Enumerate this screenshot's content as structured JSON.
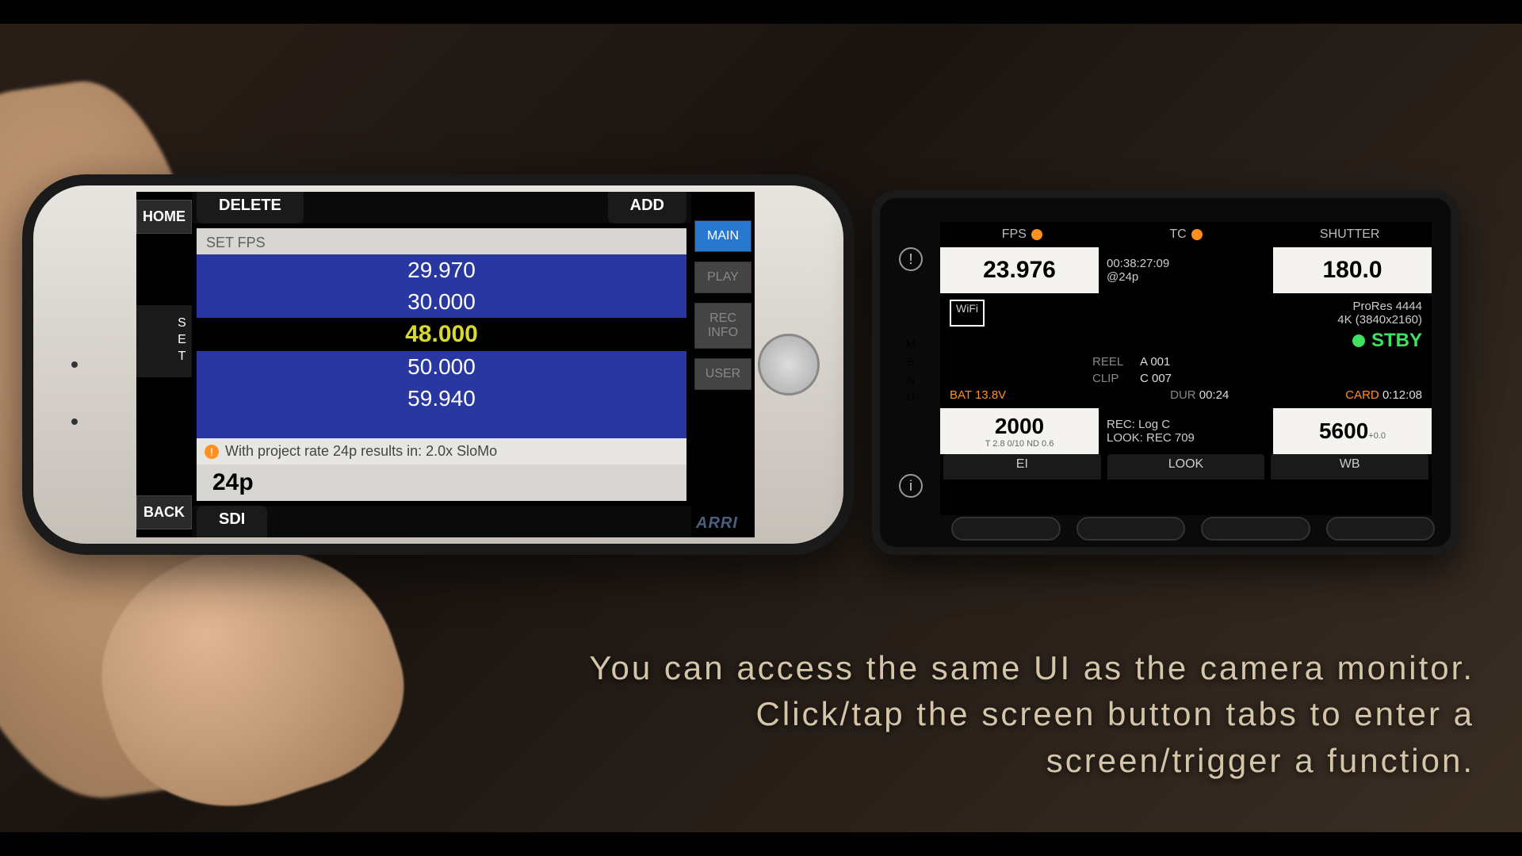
{
  "phone_app": {
    "home_label": "HOME",
    "back_label": "BACK",
    "set_label": "SET",
    "top_tabs": {
      "delete": "DELETE",
      "add": "ADD"
    },
    "bottom_tab": "SDI",
    "panel_title": "SET FPS",
    "fps_options": [
      "29.970",
      "30.000",
      "48.000",
      "50.000",
      "59.940"
    ],
    "fps_selected_index": 2,
    "info_text": "With project rate 24p results in: 2.0x SloMo",
    "current_rate": "24p",
    "right_buttons": [
      "MAIN",
      "PLAY",
      "REC INFO",
      "USER"
    ],
    "right_active_index": 0,
    "brand": "ARRI"
  },
  "camera": {
    "menu_label": "MENU",
    "header": {
      "fps": "FPS",
      "tc": "TC",
      "shutter": "SHUTTER"
    },
    "fps_value": "23.976",
    "tc_value": "00:38:27:09",
    "tc_sub": "@24p",
    "shutter_value": "180.0",
    "wifi": "WiFi",
    "format": "ProRes 4444",
    "resolution": "4K (3840x2160)",
    "status": "STBY",
    "reel_label": "REEL",
    "reel_value": "A 001",
    "clip_label": "CLIP",
    "clip_value": "C 007",
    "dur_label": "DUR",
    "dur_value": "00:24",
    "bat_label": "BAT",
    "bat_value": "13.8V",
    "card_label": "CARD",
    "card_value": "0:12:08",
    "ei_value": "2000",
    "ei_sub": "T 2.8  0/10   ND 0.6",
    "rec_label": "REC: Log C",
    "look_label": "LOOK: REC 709",
    "wb_value": "5600",
    "wb_sub": "+0.0",
    "footer": {
      "ei": "EI",
      "look": "LOOK",
      "wb": "WB"
    }
  },
  "caption": {
    "line1": "You can access the same UI as the camera monitor.",
    "line2": "Click/tap the screen button tabs to enter a",
    "line3": "screen/trigger a function."
  }
}
